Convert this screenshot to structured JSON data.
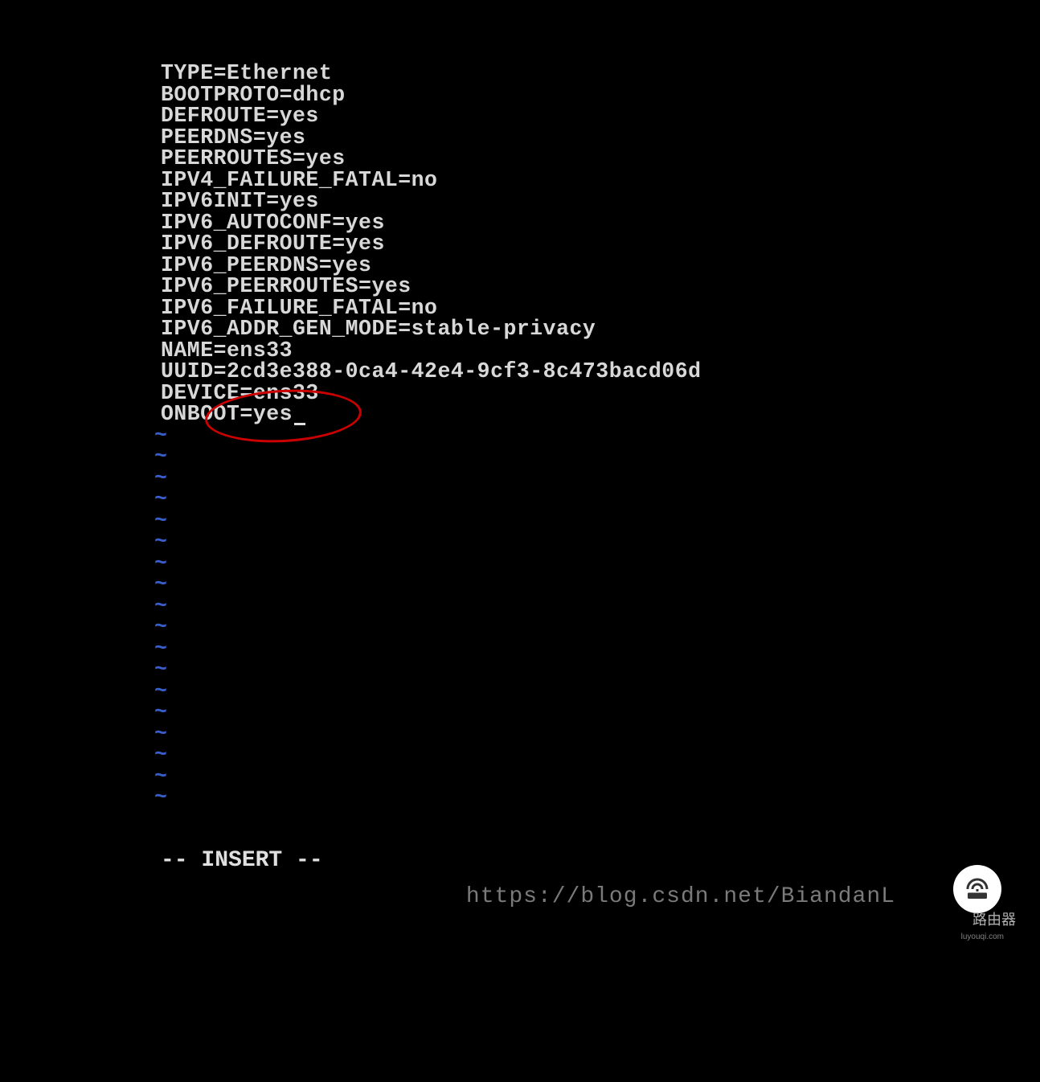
{
  "config_lines": [
    "TYPE=Ethernet",
    "BOOTPROTO=dhcp",
    "DEFROUTE=yes",
    "PEERDNS=yes",
    "PEERROUTES=yes",
    "IPV4_FAILURE_FATAL=no",
    "IPV6INIT=yes",
    "IPV6_AUTOCONF=yes",
    "IPV6_DEFROUTE=yes",
    "IPV6_PEERDNS=yes",
    "IPV6_PEERROUTES=yes",
    "IPV6_FAILURE_FATAL=no",
    "IPV6_ADDR_GEN_MODE=stable-privacy",
    "NAME=ens33",
    "UUID=2cd3e388-0ca4-42e4-9cf3-8c473bacd06d",
    "DEVICE=ens33"
  ],
  "last_line": "ONBOOT=yes",
  "tilde_count": 18,
  "status_line": "-- INSERT --",
  "watermark": "https://blog.csdn.net/BiandanL",
  "badge": {
    "label": "路由器",
    "sublabel": "luyouqi.com"
  },
  "annotation": {
    "type": "ellipse",
    "color": "#cc0000",
    "highlights": "ONBOOT=yes"
  }
}
